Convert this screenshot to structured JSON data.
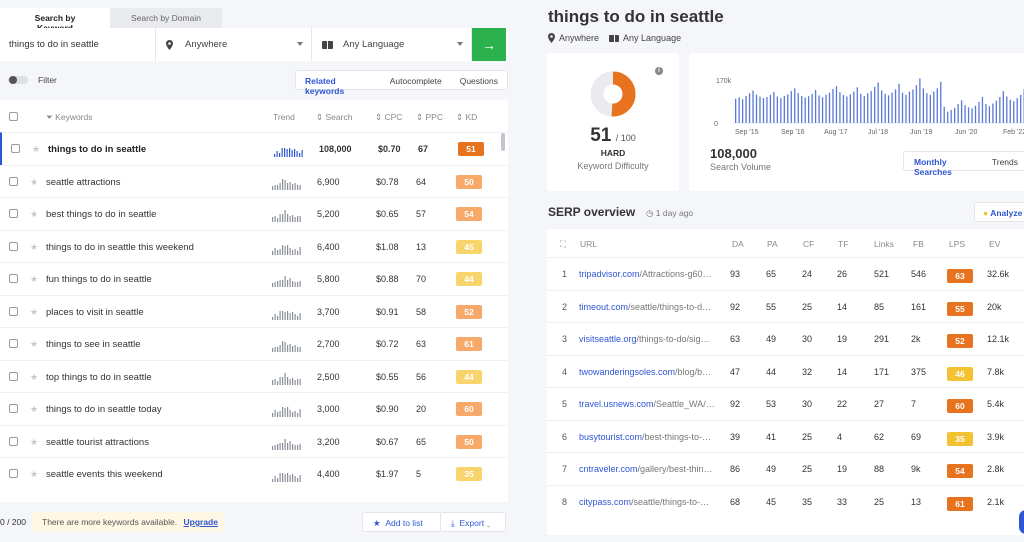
{
  "tabs": {
    "by_keyword": "Search by Keyword",
    "by_domain": "Search by Domain"
  },
  "search": {
    "query": "things to do in seattle",
    "location": "Anywhere",
    "language": "Any Language",
    "go": "→"
  },
  "filter": {
    "label": "Filter",
    "modes": [
      "Related keywords",
      "Autocomplete",
      "Questions"
    ]
  },
  "kw_table": {
    "headers": {
      "keywords": "Keywords",
      "trend": "Trend",
      "search": "Search",
      "cpc": "CPC",
      "ppc": "PPC",
      "kd": "KD"
    },
    "rows": [
      {
        "keyword": "things to do in seattle",
        "search": "108,000",
        "cpc": "$0.70",
        "ppc": "67",
        "kd": "51",
        "kd_color": "#e8731e"
      },
      {
        "keyword": "seattle attractions",
        "search": "6,900",
        "cpc": "$0.78",
        "ppc": "64",
        "kd": "50",
        "kd_color": "#f6a968"
      },
      {
        "keyword": "best things to do in seattle",
        "search": "5,200",
        "cpc": "$0.65",
        "ppc": "57",
        "kd": "54",
        "kd_color": "#f6a968"
      },
      {
        "keyword": "things to do in seattle this weekend",
        "search": "6,400",
        "cpc": "$1.08",
        "ppc": "13",
        "kd": "45",
        "kd_color": "#f8d56c"
      },
      {
        "keyword": "fun things to do in seattle",
        "search": "5,800",
        "cpc": "$0.88",
        "ppc": "70",
        "kd": "44",
        "kd_color": "#f8d56c"
      },
      {
        "keyword": "places to visit in seattle",
        "search": "3,700",
        "cpc": "$0.91",
        "ppc": "58",
        "kd": "52",
        "kd_color": "#f6a968"
      },
      {
        "keyword": "things to see in seattle",
        "search": "2,700",
        "cpc": "$0.72",
        "ppc": "63",
        "kd": "61",
        "kd_color": "#f6a968"
      },
      {
        "keyword": "top things to do in seattle",
        "search": "2,500",
        "cpc": "$0.55",
        "ppc": "56",
        "kd": "44",
        "kd_color": "#f8d56c"
      },
      {
        "keyword": "things to do in seattle today",
        "search": "3,000",
        "cpc": "$0.90",
        "ppc": "20",
        "kd": "60",
        "kd_color": "#f6a968"
      },
      {
        "keyword": "seattle tourist attractions",
        "search": "3,200",
        "cpc": "$0.67",
        "ppc": "65",
        "kd": "50",
        "kd_color": "#f6a968"
      },
      {
        "keyword": "seattle events this weekend",
        "search": "4,400",
        "cpc": "$1.97",
        "ppc": "5",
        "kd": "35",
        "kd_color": "#f8d56c"
      }
    ]
  },
  "bottom": {
    "count": "0 / 200",
    "more_text": "There are more keywords available.",
    "upgrade": "Upgrade",
    "add_to_list": "Add to list",
    "export": "Export"
  },
  "detail": {
    "title": "things to do in seattle",
    "location": "Anywhere",
    "language": "Any Language",
    "kd_value": "51",
    "kd_of": "/ 100",
    "kd_level": "HARD",
    "kd_label": "Keyword Difficulty",
    "kd_fraction": 0.51,
    "sv_value": "108,000",
    "sv_label": "Search Volume",
    "sv_tabs": [
      "Monthly Searches",
      "Trends"
    ],
    "chart_data": {
      "type": "bar",
      "y_ticks": [
        "170k",
        "0"
      ],
      "x_ticks": [
        "Sep '15",
        "Sep '16",
        "Aug '17",
        "Jul '18",
        "Jun '19",
        "Jun '20",
        "Feb '22"
      ],
      "values": [
        90,
        95,
        88,
        100,
        110,
        120,
        105,
        98,
        92,
        96,
        104,
        115,
        98,
        92,
        100,
        106,
        118,
        128,
        110,
        100,
        94,
        99,
        108,
        122,
        102,
        95,
        104,
        112,
        126,
        136,
        114,
        104,
        98,
        106,
        116,
        132,
        108,
        100,
        110,
        118,
        134,
        150,
        120,
        108,
        102,
        112,
        124,
        145,
        112,
        104,
        116,
        124,
        140,
        165,
        128,
        110,
        104,
        116,
        128,
        152,
        60,
        42,
        48,
        56,
        70,
        84,
        66,
        58,
        54,
        64,
        78,
        96,
        70,
        62,
        72,
        82,
        96,
        118,
        98,
        86,
        80,
        92,
        104,
        126
      ]
    },
    "serp": {
      "title": "SERP overview",
      "when": "1 day ago",
      "analyze": "Analyze",
      "headers": [
        "URL",
        "DA",
        "PA",
        "CF",
        "TF",
        "Links",
        "FB",
        "LPS",
        "EV"
      ],
      "rows": [
        {
          "n": "1",
          "domain": "tripadvisor.com",
          "path": "/Attractions-g60…",
          "da": "93",
          "pa": "65",
          "cf": "24",
          "tf": "26",
          "links": "521",
          "fb": "546",
          "lps": "63",
          "lps_color": "#e8731e",
          "ev": "32.6k"
        },
        {
          "n": "2",
          "domain": "timeout.com",
          "path": "/seattle/things-to-d…",
          "da": "92",
          "pa": "55",
          "cf": "25",
          "tf": "14",
          "links": "85",
          "fb": "161",
          "lps": "55",
          "lps_color": "#e8731e",
          "ev": "20k"
        },
        {
          "n": "3",
          "domain": "visitseattle.org",
          "path": "/things-to-do/sig…",
          "da": "63",
          "pa": "49",
          "cf": "30",
          "tf": "19",
          "links": "291",
          "fb": "2k",
          "lps": "52",
          "lps_color": "#e8731e",
          "ev": "12.1k"
        },
        {
          "n": "4",
          "domain": "twowanderingsoles.com",
          "path": "/blog/b…",
          "da": "47",
          "pa": "44",
          "cf": "32",
          "tf": "14",
          "links": "171",
          "fb": "375",
          "lps": "46",
          "lps_color": "#f2c233",
          "ev": "7.8k"
        },
        {
          "n": "5",
          "domain": "travel.usnews.com",
          "path": "/Seattle_WA/…",
          "da": "92",
          "pa": "53",
          "cf": "30",
          "tf": "22",
          "links": "27",
          "fb": "7",
          "lps": "60",
          "lps_color": "#e8731e",
          "ev": "5.4k"
        },
        {
          "n": "6",
          "domain": "busytourist.com",
          "path": "/best-things-to-…",
          "da": "39",
          "pa": "41",
          "cf": "25",
          "tf": "4",
          "links": "62",
          "fb": "69",
          "lps": "35",
          "lps_color": "#f2c233",
          "ev": "3.9k"
        },
        {
          "n": "7",
          "domain": "cntraveler.com",
          "path": "/gallery/best-thin…",
          "da": "86",
          "pa": "49",
          "cf": "25",
          "tf": "19",
          "links": "88",
          "fb": "9k",
          "lps": "54",
          "lps_color": "#e8731e",
          "ev": "2.8k"
        },
        {
          "n": "8",
          "domain": "citypass.com",
          "path": "/seattle/things-to-…",
          "da": "68",
          "pa": "45",
          "cf": "35",
          "tf": "33",
          "links": "25",
          "fb": "13",
          "lps": "61",
          "lps_color": "#e8731e",
          "ev": "2.1k"
        }
      ]
    }
  }
}
